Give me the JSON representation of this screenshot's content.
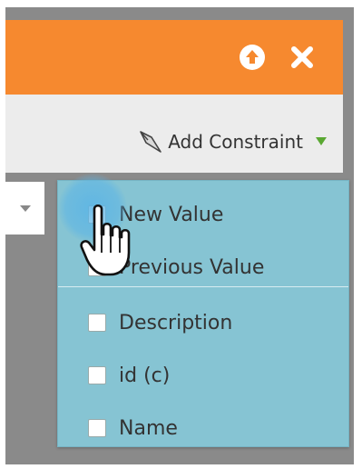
{
  "toolbar": {
    "add_constraint_label": "Add Constraint"
  },
  "menu": {
    "items": [
      {
        "label": "New Value"
      },
      {
        "label": "Previous Value"
      },
      {
        "label": "Description"
      },
      {
        "label": "id (c)"
      },
      {
        "label": "Name"
      }
    ]
  },
  "icons": {
    "header": [
      "arrow-up-circle-icon",
      "close-icon"
    ],
    "toolbar": [
      "wand-icon",
      "dropdown-triangle-icon"
    ],
    "cursor": "hand-pointer-icon"
  },
  "colors": {
    "header": "#f6892f",
    "menu": "#86c4d3",
    "accent_triangle": "#5aa832"
  }
}
